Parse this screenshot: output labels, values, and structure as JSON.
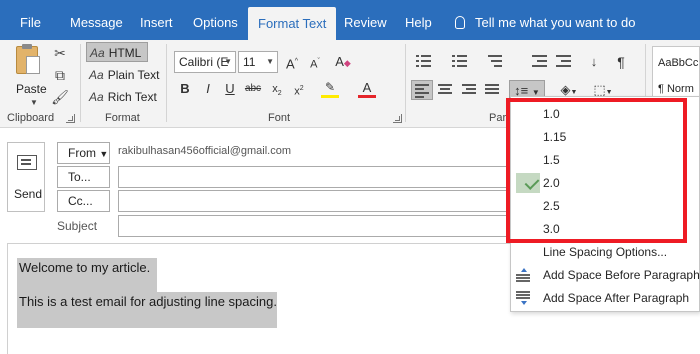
{
  "menu": {
    "tabs": [
      "File",
      "Message",
      "Insert",
      "Options",
      "Format Text",
      "Review",
      "Help"
    ],
    "active_tab": "Format Text",
    "tell_me": "Tell me what you want to do"
  },
  "ribbon": {
    "clipboard": {
      "paste_label": "Paste",
      "group_label": "Clipboard"
    },
    "format": {
      "items": [
        "HTML",
        "Plain Text",
        "Rich Text"
      ],
      "selected": "HTML",
      "group_label": "Format"
    },
    "font": {
      "font_name": "Calibri (E",
      "font_size": "11",
      "group_label": "Font"
    },
    "paragraph": {
      "group_label": "Para"
    },
    "styles": {
      "sample1": "AaBbCc",
      "sample2": "¶ Norm"
    }
  },
  "compose": {
    "send_label": "Send",
    "from_label": "From",
    "from_value": "rakibulhasan456official@gmail.com",
    "to_label": "To...",
    "cc_label": "Cc...",
    "subject_label": "Subject",
    "to_value": "",
    "cc_value": "",
    "subject_value": ""
  },
  "body": {
    "paragraphs": [
      "Welcome to my article.",
      "This is a test email for adjusting line spacing."
    ]
  },
  "line_spacing_menu": {
    "options": [
      "1.0",
      "1.15",
      "1.5",
      "2.0",
      "2.5",
      "3.0"
    ],
    "selected": "2.0",
    "line_spacing_options": "Line Spacing Options...",
    "add_space_before": "Add Space Before Paragraph",
    "add_space_after": "Add Space After Paragraph"
  },
  "colors": {
    "title_bar": "#2b6ebc",
    "ribbon_bg": "#f3f3f3",
    "highlight": "#c8c8c8",
    "annotation_frame": "#ee1b24",
    "check_green": "#5a9a57"
  }
}
